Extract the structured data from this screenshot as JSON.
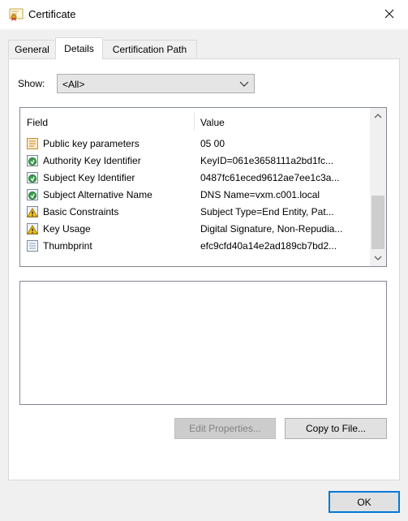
{
  "window": {
    "title": "Certificate",
    "icon": "certificate-icon"
  },
  "tabs": [
    {
      "label": "General",
      "active": false
    },
    {
      "label": "Details",
      "active": true
    },
    {
      "label": "Certification Path",
      "active": false
    }
  ],
  "show": {
    "label": "Show:",
    "selected": "<All>"
  },
  "list": {
    "headers": {
      "field": "Field",
      "value": "Value"
    },
    "rows": [
      {
        "field": "Public key parameters",
        "value": "05 00",
        "icon": "certificate-field-icon"
      },
      {
        "field": "Authority Key Identifier",
        "value": "KeyID=061e3658111a2bd1fc...",
        "icon": "extension-icon"
      },
      {
        "field": "Subject Key Identifier",
        "value": "0487fc61eced9612ae7ee1c3a...",
        "icon": "extension-icon"
      },
      {
        "field": "Subject Alternative Name",
        "value": "DNS Name=vxm.c001.local",
        "icon": "extension-icon"
      },
      {
        "field": "Basic Constraints",
        "value": "Subject Type=End Entity, Pat...",
        "icon": "critical-extension-icon"
      },
      {
        "field": "Key Usage",
        "value": "Digital Signature, Non-Repudia...",
        "icon": "critical-extension-icon"
      },
      {
        "field": "Thumbprint",
        "value": "efc9cfd40a14e2ad189cb7bd2...",
        "icon": "property-icon"
      }
    ]
  },
  "buttons": {
    "edit_properties": "Edit Properties...",
    "copy_to_file": "Copy to File...",
    "ok": "OK"
  },
  "colors": {
    "accent": "#0078d7",
    "dialog_bg": "#f0f0f0",
    "panel_bg": "#ffffff"
  }
}
